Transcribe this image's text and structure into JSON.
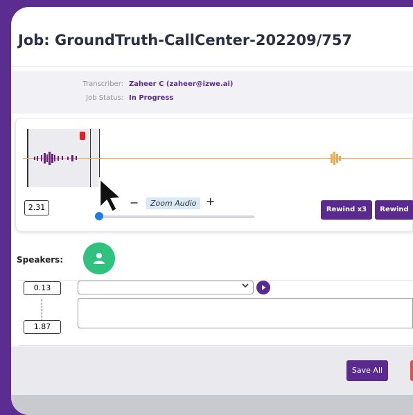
{
  "job": {
    "title": "Job: GroundTruth-CallCenter-202209/757"
  },
  "info": {
    "transcriber_label": "Transcriber:",
    "transcriber_value": "Zaheer C (zaheer@izwe.ai)",
    "status_label": "Job Status:",
    "status_value": "In Progress"
  },
  "audio": {
    "current_time": "2.31",
    "zoom_minus": "−",
    "zoom_label": "Zoom Audio",
    "zoom_plus": "+",
    "zoom_level": 0.0,
    "rewind_x3_label": "Rewind x3",
    "rewind_label": "Rewind"
  },
  "speakers": {
    "label": "Speakers:"
  },
  "segment": {
    "start": "0.13",
    "end": "1.87",
    "speaker_value": "",
    "text": ""
  },
  "footer": {
    "save_all_label": "Save All"
  },
  "colors": {
    "brand_purple": "#5a2a8f",
    "speaker_green": "#2ec27e",
    "waveform_purple": "#6a1d84",
    "waveform_orange": "#f3a64e"
  },
  "icons": [
    "person-icon",
    "play-icon",
    "chevron-down-icon",
    "cursor-arrow-icon",
    "marker-icon"
  ]
}
